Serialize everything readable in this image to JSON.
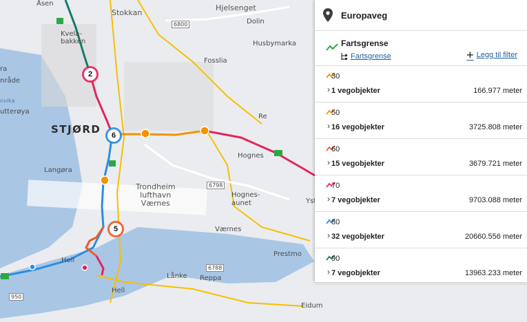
{
  "map": {
    "labels": {
      "asen": "Åsen",
      "stokkan": "Stokkan",
      "hjelsenget": "Hjelsenget",
      "road_6800": "6800",
      "dolin": "Dolin",
      "kvelabakken": "Kvela-\nbakken",
      "husbymarka": "Husbymarka",
      "fosslia": "Fosslia",
      "ra": "ra",
      "omrade": "nråde",
      "vika": "nvika",
      "utterøya": "utterøya",
      "stjordal": "STJØRD",
      "re": "Re",
      "hognes": "Hognes",
      "langora": "Langøra",
      "trondheim_lufthavn": "Trondheim\nlufthavn\nVærnes",
      "road_6798": "6798",
      "hognesaunet": "Hognes-\naunet",
      "yst": "Yst",
      "varnes": "Værnes",
      "hell": "Hell",
      "prestmo": "Prestmo",
      "road_6788": "6788",
      "lanke": "Lånke",
      "reppa": "Reppa",
      "hell2": "Hell",
      "road_950": "950",
      "eidum": "Eidum"
    },
    "badges": [
      "2",
      "6",
      "5"
    ]
  },
  "panel": {
    "title": "Europaveg",
    "category": {
      "title": "Fartsgrense",
      "sub_link": "Fartsgrense",
      "add_filter": "Legg til filter"
    },
    "rows": [
      {
        "value": "30",
        "count": "1 vegobjekter",
        "length": "166.977 meter",
        "color": "#f39200"
      },
      {
        "value": "50",
        "count": "16 vegobjekter",
        "length": "3725.808 meter",
        "color": "#f39200"
      },
      {
        "value": "60",
        "count": "15 vegobjekter",
        "length": "3679.721 meter",
        "color": "#f05a28"
      },
      {
        "value": "70",
        "count": "7 vegobjekter",
        "length": "9703.088 meter",
        "color": "#e4245c"
      },
      {
        "value": "80",
        "count": "32 vegobjekter",
        "length": "20660.556 meter",
        "color": "#2b8de3"
      },
      {
        "value": "90",
        "count": "7 vegobjekter",
        "length": "13963.233 meter",
        "color": "#137a6a"
      }
    ]
  },
  "colors": {
    "green": "#2aa845",
    "orange": "#f39200",
    "red": "#e4245c",
    "blue": "#2b8de3",
    "teal": "#137a6a",
    "link": "#1a5fa0"
  }
}
